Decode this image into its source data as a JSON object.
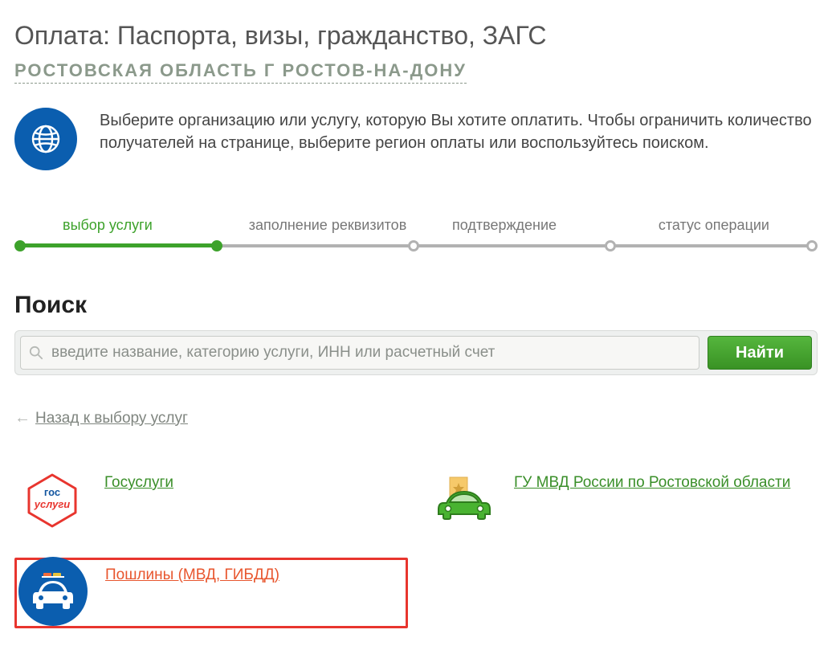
{
  "page_title": "Оплата: Паспорта, визы, гражданство, ЗАГС",
  "region": "РОСТОВСКАЯ ОБЛАСТЬ Г РОСТОВ-НА-ДОНУ",
  "info_text": "Выберите организацию или услугу, которую Вы хотите оплатить. Чтобы ограничить количество получателей на странице, выберите регион оплаты или воспользуйтесь поиском.",
  "steps": [
    {
      "label": "выбор услуги",
      "state": "active"
    },
    {
      "label": "заполнение реквизитов",
      "state": "inactive"
    },
    {
      "label": "подтверждение",
      "state": "inactive"
    },
    {
      "label": "статус операции",
      "state": "inactive"
    }
  ],
  "search": {
    "title": "Поиск",
    "placeholder": "введите название, категорию услуги, ИНН или расчетный счет",
    "button_label": "Найти"
  },
  "back_link": "Назад к выбору услуг",
  "gos_icon": {
    "line1": "гос",
    "line2": "услуги"
  },
  "services": [
    {
      "label": "Госуслуги",
      "icon": "gosuslugi-icon",
      "highlighted": false
    },
    {
      "label": "ГУ МВД России по Ростовской области",
      "icon": "shield-car-icon",
      "highlighted": false
    },
    {
      "label": "Пошлины (МВД, ГИБДД)",
      "icon": "police-car-icon",
      "highlighted": true
    }
  ]
}
